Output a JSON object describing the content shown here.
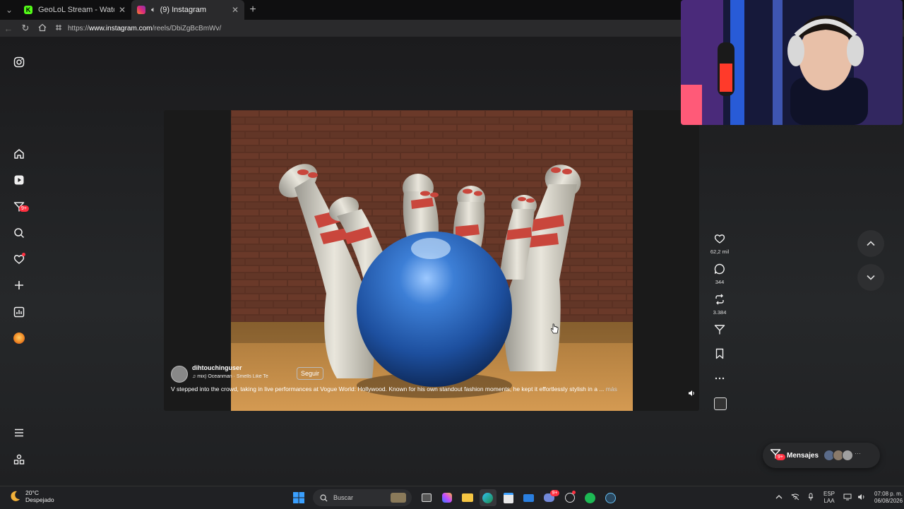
{
  "browser": {
    "tabs": [
      {
        "title": "GeoLoL Stream - Watch Live o",
        "active": false,
        "favicon_color": "#53fc18"
      },
      {
        "title": "(9) Instagram",
        "active": true,
        "favicon_color": "#e1306c"
      }
    ],
    "url_prefix": "https://",
    "url_host": "www.instagram.com",
    "url_path": "/reels/DbiZgBcBmWv/"
  },
  "sidebar": {
    "items": [
      {
        "name": "instagram-logo-icon"
      },
      {
        "name": "home-icon"
      },
      {
        "name": "reels-icon"
      },
      {
        "name": "messages-icon",
        "badge": "9+"
      },
      {
        "name": "search-icon"
      },
      {
        "name": "notifications-icon"
      },
      {
        "name": "create-icon"
      },
      {
        "name": "dashboard-icon"
      },
      {
        "name": "profile-avatar"
      },
      {
        "name": "menu-icon"
      },
      {
        "name": "also-from-meta-icon"
      }
    ]
  },
  "reel": {
    "username": "dihtouchinguser",
    "song": "mix)  Oceanman · Smells Like Te",
    "follow_label": "Seguir",
    "caption": "V stepped into the crowd, taking in live performances at Vogue World: Hollywood. Known for his own standout fashion moments, he kept it effortlessly stylish in a ...",
    "more_label": "más"
  },
  "actions": {
    "likes": "62,2 mil",
    "comments": "344",
    "reposts": "3.384"
  },
  "messages": {
    "label": "Mensajes",
    "badge": "9+"
  },
  "taskbar": {
    "temperature": "20°C",
    "weather": "Despejado",
    "search_placeholder": "Buscar",
    "language": "ESP",
    "layout": "LAA",
    "time": "07:08 p. m.",
    "date": "06/08/2026",
    "discord_badge": "9+"
  },
  "colors": {
    "accent": "#ff3040",
    "page_bg": "#1c1c1e"
  }
}
